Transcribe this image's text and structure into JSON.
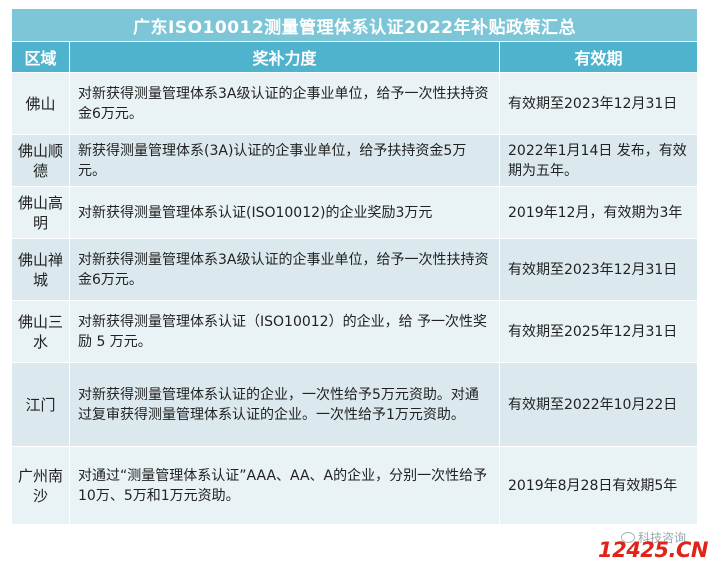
{
  "title": "广东ISO10012测量管理体系认证2022年补贴政策汇总",
  "headers": {
    "region": "区域",
    "subsidy": "奖补力度",
    "validity": "有效期"
  },
  "rows": [
    {
      "region": "佛山",
      "subsidy": "对新获得测量管理体系3A级认证的企事业单位，给予一次性扶持资金6万元。",
      "validity": "有效期至2023年12月31日"
    },
    {
      "region": "佛山顺德",
      "subsidy": "新获得测量管理体系(3A)认证的企事业单位，给予扶持资金5万元。",
      "validity": "2022年1月14日 发布，有效期为五年。"
    },
    {
      "region": "佛山高明",
      "subsidy": "对新获得测量管理体系认证(ISO10012)的企业奖励3万元",
      "validity": "2019年12月，有效期为3年"
    },
    {
      "region": "佛山禅城",
      "subsidy": "对新获得测量管理体系3A级认证的企事业单位，给予一次性扶持资金6万元。",
      "validity": "有效期至2023年12月31日"
    },
    {
      "region": "佛山三水",
      "subsidy": "对新获得测量管理体系认证（ISO10012）的企业，给 予一次性奖励 5 万元。",
      "validity": "有效期至2025年12月31日"
    },
    {
      "region": "江门",
      "subsidy": "对新获得测量管理体系认证的企业，一次性给予5万元资助。对通过复审获得测量管理体系认证的企业。一次性给予1万元资助。",
      "validity": "有效期至2022年10月22日"
    },
    {
      "region": "广州南沙",
      "subsidy": "对通过“测量管理体系认证”AAA、AA、A的企业，分别一次性给予10万、5万和1万元资助。",
      "validity": "2019年8月28日有效期5年"
    }
  ],
  "watermark": {
    "account": "科技咨询",
    "logo": "12425.CN",
    "icon": "wechat-icon"
  }
}
